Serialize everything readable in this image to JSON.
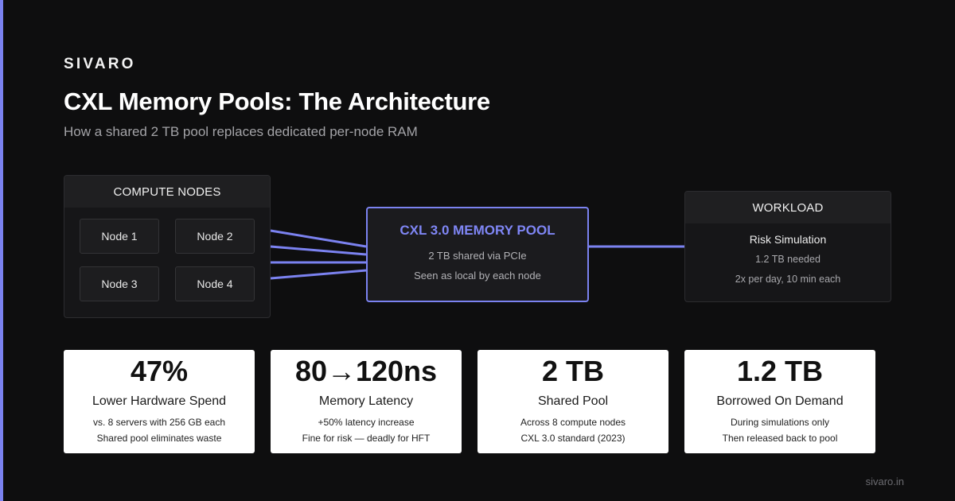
{
  "brand": "SIVARO",
  "title": "CXL Memory Pools: The Architecture",
  "subtitle": "How a shared 2 TB pool replaces dedicated per-node RAM",
  "compute": {
    "header": "COMPUTE NODES",
    "nodes": [
      "Node 1",
      "Node 2",
      "Node 3",
      "Node 4"
    ]
  },
  "pool": {
    "title": "CXL 3.0 MEMORY POOL",
    "line1": "2 TB shared via PCIe",
    "line2": "Seen as local by each node"
  },
  "workload": {
    "header": "WORKLOAD",
    "name": "Risk Simulation",
    "line1": "1.2 TB needed",
    "line2": "2x per day, 10 min each"
  },
  "stats": [
    {
      "value": "47%",
      "label": "Lower Hardware Spend",
      "line1": "vs. 8 servers with 256 GB each",
      "line2": "Shared pool eliminates waste"
    },
    {
      "value": "80→120ns",
      "label": "Memory Latency",
      "line1": "+50% latency increase",
      "line2": "Fine for risk — deadly for HFT"
    },
    {
      "value": "2 TB",
      "label": "Shared Pool",
      "line1": "Across 8 compute nodes",
      "line2": "CXL 3.0 standard (2023)"
    },
    {
      "value": "1.2 TB",
      "label": "Borrowed On Demand",
      "line1": "During simulations only",
      "line2": "Then released back to pool"
    }
  ],
  "footer": "sivaro.in",
  "colors": {
    "accent": "#7b82f0",
    "background": "#0e0e0f",
    "card": "#ffffff"
  }
}
